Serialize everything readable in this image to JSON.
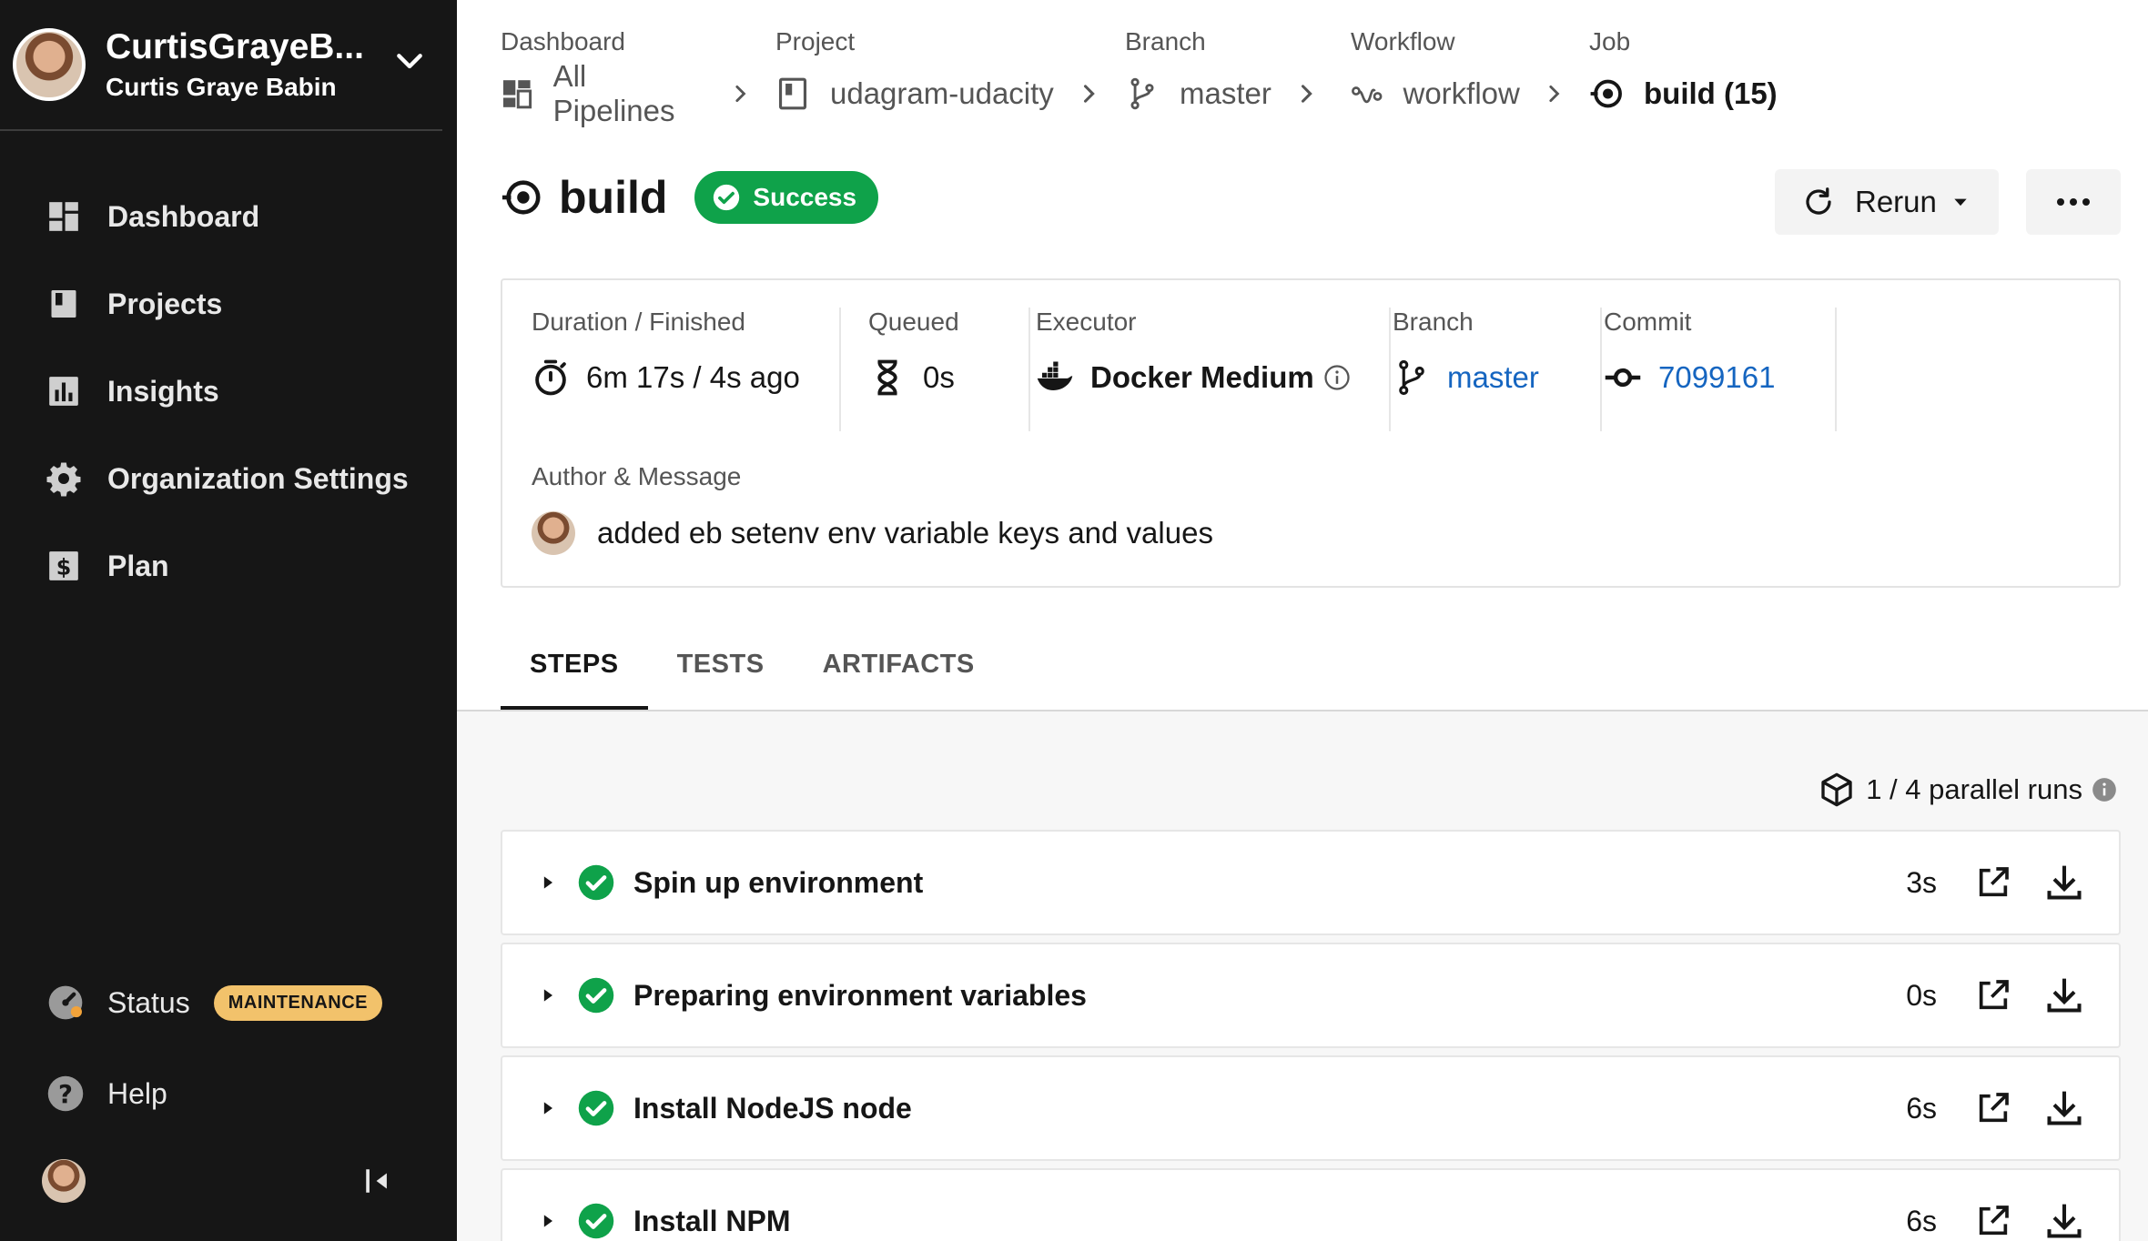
{
  "sidebar": {
    "org_title": "CurtisGrayeB...",
    "org_subtitle": "Curtis Graye Babin",
    "nav": [
      {
        "label": "Dashboard",
        "icon": "dashboard-icon"
      },
      {
        "label": "Projects",
        "icon": "projects-icon"
      },
      {
        "label": "Insights",
        "icon": "insights-icon"
      },
      {
        "label": "Organization Settings",
        "icon": "gear-icon"
      },
      {
        "label": "Plan",
        "icon": "dollar-icon"
      }
    ],
    "status_label": "Status",
    "status_badge": "MAINTENANCE",
    "help_label": "Help"
  },
  "breadcrumbs": [
    {
      "label": "Dashboard",
      "value": "All Pipelines",
      "icon": "pipelines-icon"
    },
    {
      "label": "Project",
      "value": "udagram-udacity",
      "icon": "book-icon"
    },
    {
      "label": "Branch",
      "value": "master",
      "icon": "branch-icon"
    },
    {
      "label": "Workflow",
      "value": "workflow",
      "icon": "workflow-icon"
    },
    {
      "label": "Job",
      "value": "build (15)",
      "icon": "job-icon"
    }
  ],
  "header": {
    "title": "build",
    "status": "Success",
    "rerun_label": "Rerun",
    "more_label": "..."
  },
  "info": {
    "duration_label": "Duration / Finished",
    "duration_value": "6m 17s / 4s ago",
    "queued_label": "Queued",
    "queued_value": "0s",
    "executor_label": "Executor",
    "executor_value": "Docker Medium",
    "branch_label": "Branch",
    "branch_value": "master",
    "commit_label": "Commit",
    "commit_value": "7099161",
    "author_label": "Author & Message",
    "message": "added eb setenv env variable keys and values"
  },
  "tabs": [
    "STEPS",
    "TESTS",
    "ARTIFACTS"
  ],
  "active_tab": "STEPS",
  "parallel_runs": "1 / 4 parallel runs",
  "steps": [
    {
      "name": "Spin up environment",
      "duration": "3s"
    },
    {
      "name": "Preparing environment variables",
      "duration": "0s"
    },
    {
      "name": "Install NodeJS node",
      "duration": "6s"
    },
    {
      "name": "Install NPM",
      "duration": "6s"
    }
  ],
  "colors": {
    "success": "#0fa24a",
    "link": "#1565c0",
    "sidebar_bg": "#161616",
    "maintenance": "#f2c26b"
  }
}
